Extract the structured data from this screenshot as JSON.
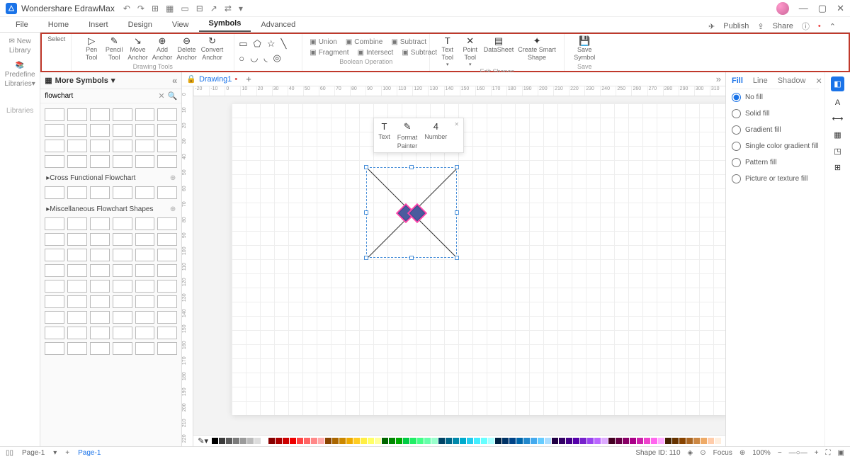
{
  "title": "Wondershare EdrawMax",
  "menus": [
    "File",
    "Home",
    "Insert",
    "Design",
    "View",
    "Symbols",
    "Advanced"
  ],
  "active_menu": "Symbols",
  "publish": "Publish",
  "share": "Share",
  "leftcol": {
    "new_library": "New Library",
    "predefine": "Predefine Libraries",
    "libraries": "Libraries"
  },
  "ribbon": {
    "select": "Select",
    "tools": [
      {
        "label1": "Pen",
        "label2": "Tool"
      },
      {
        "label1": "Pencil",
        "label2": "Tool"
      },
      {
        "label1": "Move",
        "label2": "Anchor"
      },
      {
        "label1": "Add",
        "label2": "Anchor"
      },
      {
        "label1": "Delete",
        "label2": "Anchor"
      },
      {
        "label1": "Convert",
        "label2": "Anchor"
      }
    ],
    "drawing_tools": "Drawing Tools",
    "boolean": {
      "row1": [
        "Union",
        "Combine",
        "Subtract"
      ],
      "row2": [
        "Fragment",
        "Intersect",
        "Subtract"
      ],
      "label": "Boolean Operation"
    },
    "edit": [
      {
        "label1": "Text",
        "label2": "Tool"
      },
      {
        "label1": "Point",
        "label2": "Tool"
      },
      {
        "single": "DataSheet"
      },
      {
        "label1": "Create Smart",
        "label2": "Shape"
      }
    ],
    "edit_label": "Edit Shapes",
    "save": {
      "label1": "Save",
      "label2": "Symbol",
      "group": "Save"
    }
  },
  "drawing_tab": "Drawing1",
  "ruler_h": [
    "-20",
    "-10",
    "0",
    "10",
    "20",
    "30",
    "40",
    "50",
    "60",
    "70",
    "80",
    "90",
    "100",
    "110",
    "120",
    "130",
    "140",
    "150",
    "160",
    "170",
    "180",
    "190",
    "200",
    "210",
    "220",
    "230",
    "240",
    "250",
    "260",
    "270",
    "280",
    "290",
    "300",
    "310"
  ],
  "ruler_v": [
    "0",
    "10",
    "20",
    "30",
    "40",
    "50",
    "60",
    "70",
    "80",
    "90",
    "100",
    "110",
    "120",
    "130",
    "140",
    "150",
    "160",
    "170",
    "180",
    "190",
    "200",
    "210",
    "220"
  ],
  "sym_panel": {
    "title": "More Symbols",
    "search": "flowchart",
    "sections": [
      "Cross Functional Flowchart",
      "Miscellaneous Flowchart Shapes"
    ]
  },
  "mini_toolbar": {
    "text": "Text",
    "format": "Format",
    "painter": "Painter",
    "number": "Number",
    "val": "4"
  },
  "right": {
    "tabs": [
      "Fill",
      "Line",
      "Shadow"
    ],
    "active": "Fill",
    "options": [
      "No fill",
      "Solid fill",
      "Gradient fill",
      "Single color gradient fill",
      "Pattern fill",
      "Picture or texture fill"
    ],
    "selected": "No fill"
  },
  "status": {
    "page": "Page-1",
    "page_tab": "Page-1",
    "shape_id": "Shape ID: 110",
    "focus": "Focus",
    "zoom": "100%"
  },
  "swatches": [
    "#000",
    "#3b3b3b",
    "#5b5b5b",
    "#7b7b7b",
    "#9b9b9b",
    "#bbb",
    "#ddd",
    "#fff",
    "#800",
    "#a00",
    "#c00",
    "#e00",
    "#f44",
    "#f66",
    "#f88",
    "#faa",
    "#840",
    "#a60",
    "#c80",
    "#ea0",
    "#fc2",
    "#fe4",
    "#ff6",
    "#ff9",
    "#060",
    "#080",
    "#0a0",
    "#0c4",
    "#2e6",
    "#4f8",
    "#6fa",
    "#9fc",
    "#046",
    "#068",
    "#08a",
    "#0ac",
    "#2ce",
    "#4ef",
    "#6ff",
    "#aff",
    "#024",
    "#036",
    "#048",
    "#06a",
    "#28c",
    "#4ae",
    "#6cf",
    "#adf",
    "#204",
    "#306",
    "#408",
    "#50a",
    "#72c",
    "#94e",
    "#b6f",
    "#daf",
    "#402",
    "#604",
    "#806",
    "#a08",
    "#c2a",
    "#e4c",
    "#f6e",
    "#faf",
    "#420",
    "#630",
    "#840",
    "#a62",
    "#c84",
    "#ea6",
    "#fca",
    "#fed"
  ]
}
